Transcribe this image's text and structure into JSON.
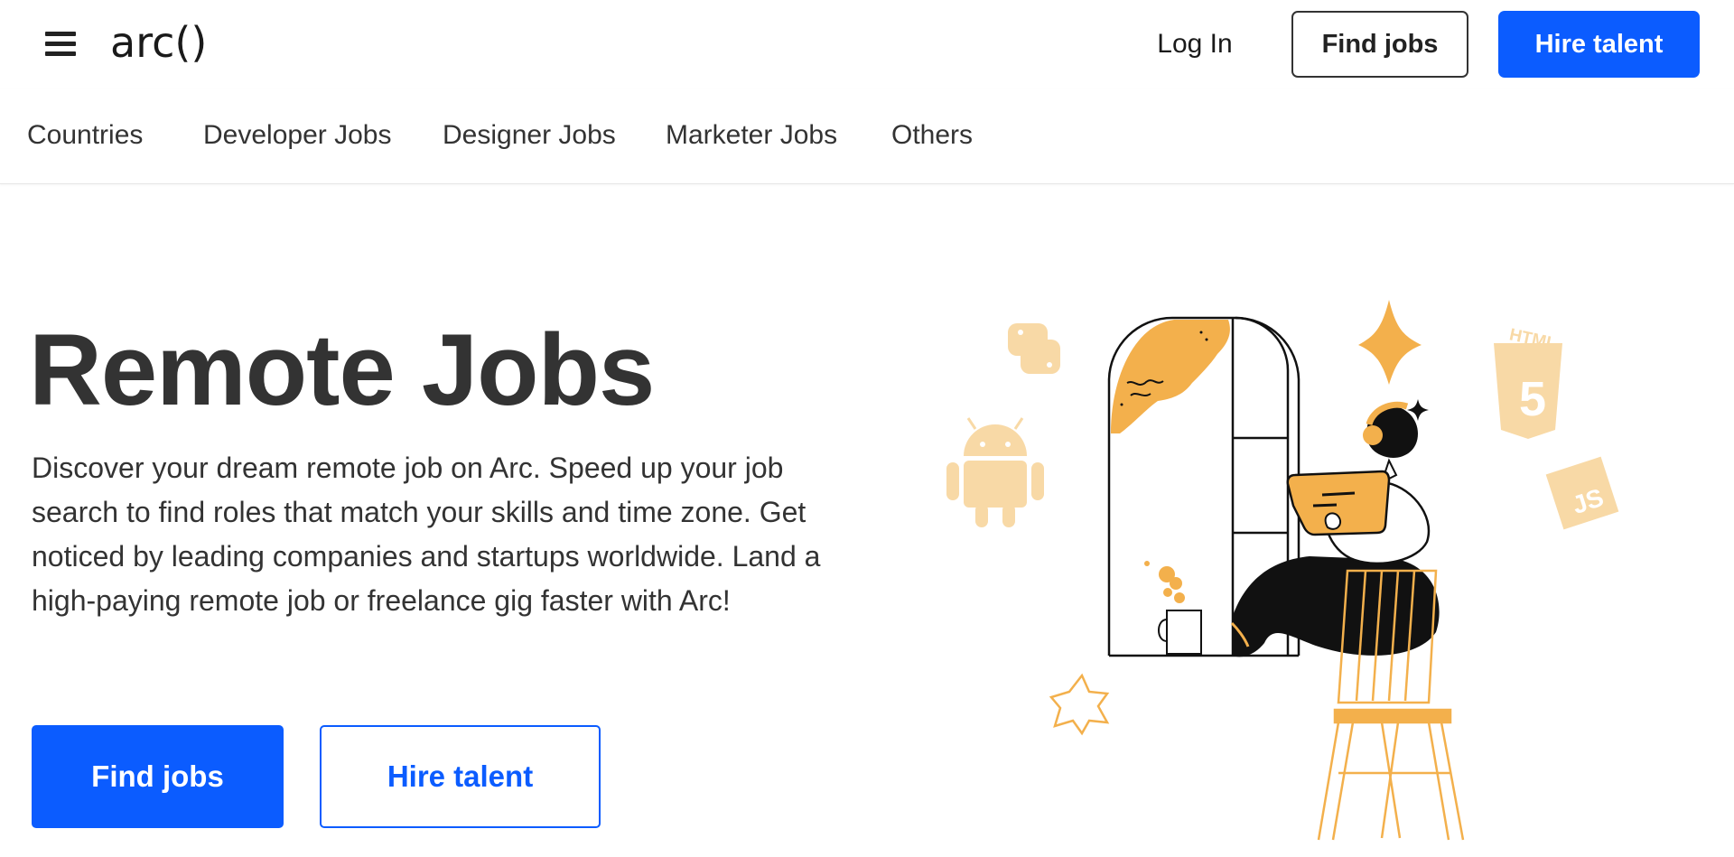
{
  "header": {
    "logo_text": "arc()",
    "login_label": "Log In",
    "find_jobs_label": "Find jobs",
    "hire_talent_label": "Hire talent"
  },
  "subnav": {
    "items": [
      {
        "label": "Countries"
      },
      {
        "label": "Developer Jobs"
      },
      {
        "label": "Designer Jobs"
      },
      {
        "label": "Marketer Jobs"
      },
      {
        "label": "Others"
      }
    ]
  },
  "hero": {
    "title": "Remote Jobs",
    "description": "Discover your dream remote job on Arc. Speed up your job search to find roles that match your skills and time zone. Get noticed by leading companies and startups worldwide. Land a high-paying remote job or freelance gig faster with Arc!",
    "find_jobs_label": "Find jobs",
    "hire_talent_label": "Hire talent"
  },
  "illustration": {
    "html_badge_text": "HTML",
    "html_version_text": "5",
    "js_badge_text": "JS"
  },
  "colors": {
    "primary_blue": "#0b5cff",
    "accent_orange": "#f3b04c",
    "text_dark": "#333333"
  }
}
